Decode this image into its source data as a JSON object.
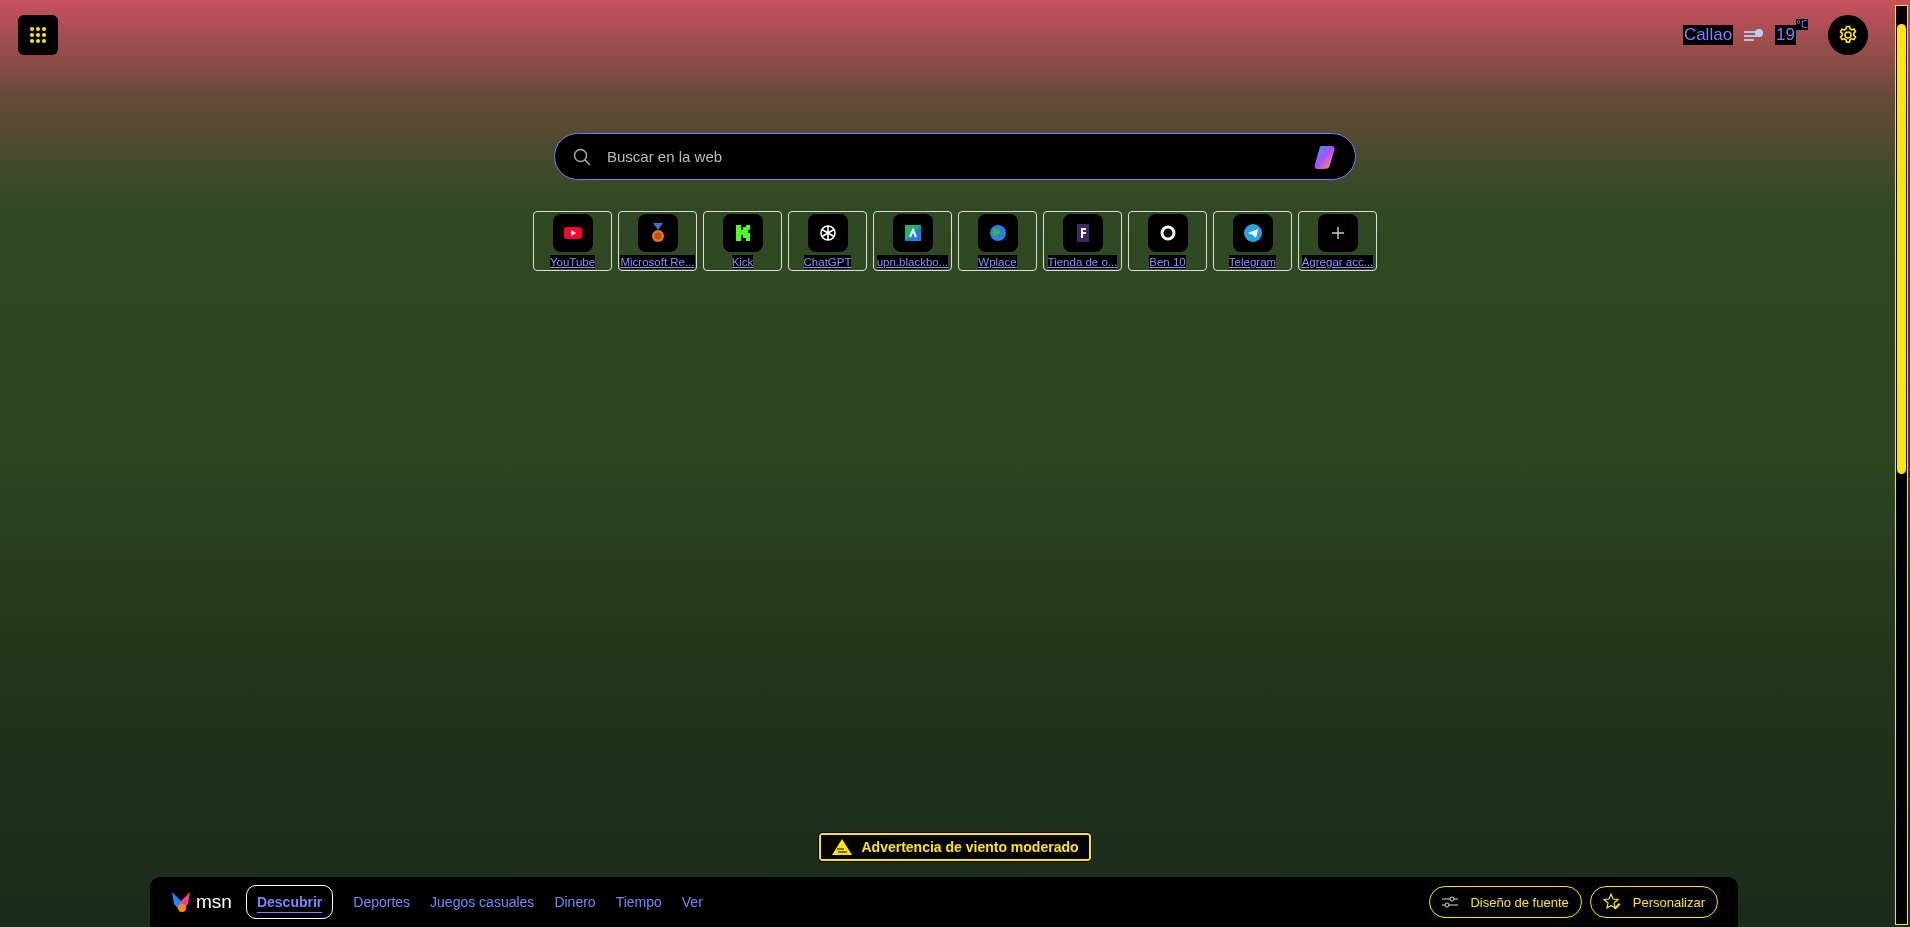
{
  "weather": {
    "location": "Callao",
    "temperature": "19",
    "unit": "°C"
  },
  "search": {
    "placeholder": "Buscar en la web"
  },
  "shortcuts": [
    {
      "label": "YouTube",
      "kind": "youtube"
    },
    {
      "label": "Microsoft Re...",
      "kind": "medal"
    },
    {
      "label": "Kick",
      "kind": "kick"
    },
    {
      "label": "ChatGPT",
      "kind": "knot"
    },
    {
      "label": "upn.blackbo...",
      "kind": "caret"
    },
    {
      "label": "Wplace",
      "kind": "globe"
    },
    {
      "label": "Tienda de o...",
      "kind": "letter"
    },
    {
      "label": "Ben 10",
      "kind": "ring"
    },
    {
      "label": "Telegram",
      "kind": "plane"
    },
    {
      "label": "Agregar acc...",
      "kind": "add"
    }
  ],
  "alert": {
    "text": "Advertencia de viento moderado"
  },
  "nav": {
    "brand": "msn",
    "tabs": [
      {
        "label": "Descubrir",
        "selected": true
      },
      {
        "label": "Deportes",
        "selected": false
      },
      {
        "label": "Juegos casuales",
        "selected": false
      },
      {
        "label": "Dinero",
        "selected": false
      },
      {
        "label": "Tiempo",
        "selected": false
      },
      {
        "label": "Ver",
        "selected": false
      }
    ]
  },
  "actions": [
    {
      "label": "Diseño de fuente",
      "kind": "font"
    },
    {
      "label": "Personalizar",
      "kind": "customize"
    }
  ]
}
